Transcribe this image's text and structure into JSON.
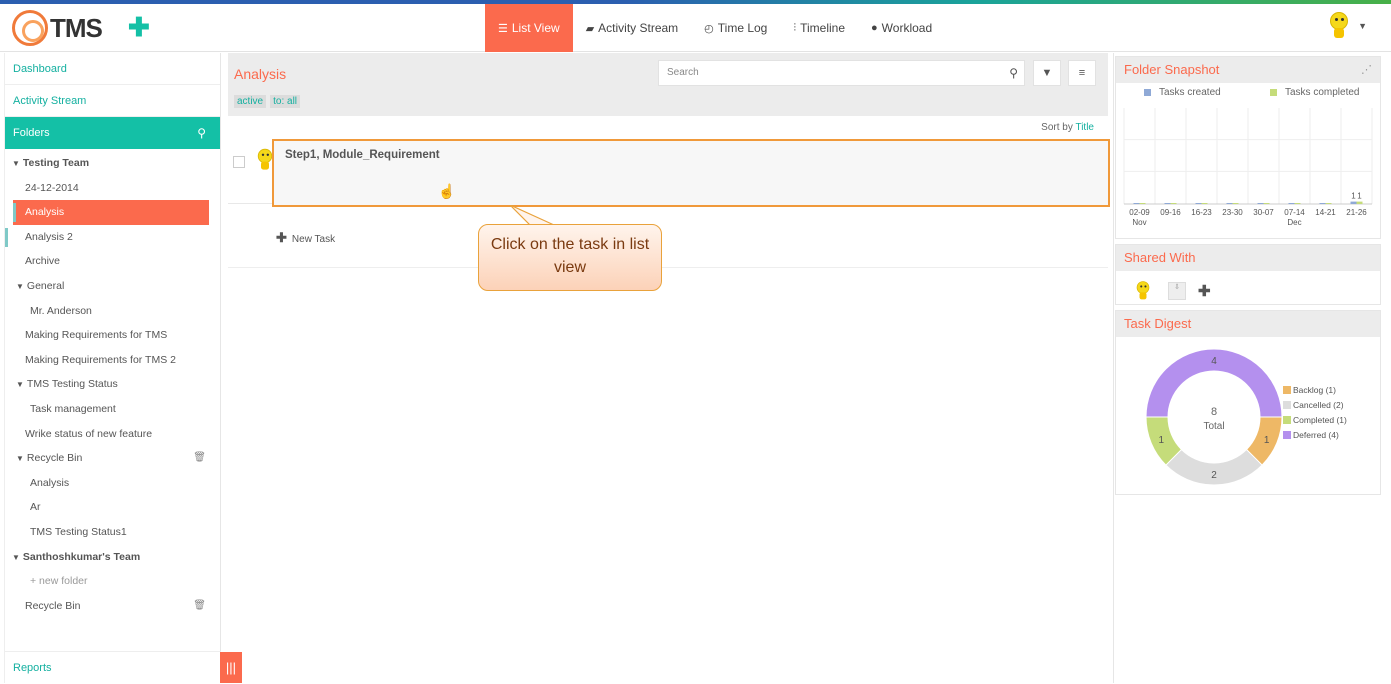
{
  "brand": {
    "name": "TMS"
  },
  "nav": {
    "tabs": [
      {
        "label": "List View",
        "icon": "list-icon",
        "active": true
      },
      {
        "label": "Activity Stream",
        "icon": "comment-icon"
      },
      {
        "label": "Time Log",
        "icon": "clock-icon"
      },
      {
        "label": "Timeline",
        "icon": "sliders-icon"
      },
      {
        "label": "Workload",
        "icon": "user-icon"
      }
    ]
  },
  "sidebar": {
    "dashboard": "Dashboard",
    "activity_stream": "Activity Stream",
    "folders": "Folders",
    "tree": [
      {
        "label": "Testing Team"
      },
      {
        "label": "24-12-2014"
      },
      {
        "label": "Analysis"
      },
      {
        "label": "Analysis 2"
      },
      {
        "label": "Archive"
      },
      {
        "label": "General"
      },
      {
        "label": "Mr. Anderson"
      },
      {
        "label": "Making Requirements for TMS"
      },
      {
        "label": "Making Requirements for TMS 2"
      },
      {
        "label": "TMS Testing Status"
      },
      {
        "label": "Task management"
      },
      {
        "label": "Wrike status of new feature"
      },
      {
        "label": "Recycle Bin"
      },
      {
        "label": "Analysis"
      },
      {
        "label": "Ar"
      },
      {
        "label": "TMS Testing Status1"
      },
      {
        "label": "Santhoshkumar's Team"
      },
      {
        "label": "+ new folder"
      },
      {
        "label": "Recycle Bin"
      }
    ],
    "reports": "Reports"
  },
  "main": {
    "title": "Analysis",
    "chips": [
      "active",
      "to: all"
    ],
    "search_placeholder": "Search",
    "sort_label": "Sort by",
    "sort_value": "Title",
    "task_title": "Step1, Module_Requirement",
    "new_task": "New Task"
  },
  "callout": {
    "text": "Click on the task in list view"
  },
  "snapshot": {
    "title": "Folder Snapshot",
    "legend": [
      "Tasks created",
      "Tasks completed"
    ],
    "colors": {
      "created": "#8fa9d6",
      "completed": "#c5dc7a"
    }
  },
  "chart_data": {
    "type": "bar",
    "categories": [
      "02-09",
      "09-16",
      "16-23",
      "23-30",
      "30-07",
      "07-14",
      "14-21",
      "21-26"
    ],
    "category_sublabels": [
      "Nov",
      "",
      "",
      "",
      "",
      "Dec",
      "",
      ""
    ],
    "series": [
      {
        "name": "Tasks created",
        "values": [
          0,
          0,
          0,
          0,
          0,
          0,
          0,
          1
        ]
      },
      {
        "name": "Tasks completed",
        "values": [
          0,
          0,
          0,
          0,
          0,
          0,
          0,
          1
        ]
      }
    ]
  },
  "shared": {
    "title": "Shared With"
  },
  "digest": {
    "title": "Task Digest",
    "total": "8",
    "total_label": "Total",
    "slices": [
      {
        "name": "Deferred",
        "value": 4,
        "color": "#b490ee",
        "legend": "Deferred (4)"
      },
      {
        "name": "Backlog",
        "value": 1,
        "color": "#eeb866",
        "legend": "Backlog (1)"
      },
      {
        "name": "Cancelled",
        "value": 2,
        "color": "#dddddd",
        "legend": "Cancelled (2)"
      },
      {
        "name": "Completed",
        "value": 1,
        "color": "#c5dc7a",
        "legend": "Completed (1)"
      }
    ]
  }
}
